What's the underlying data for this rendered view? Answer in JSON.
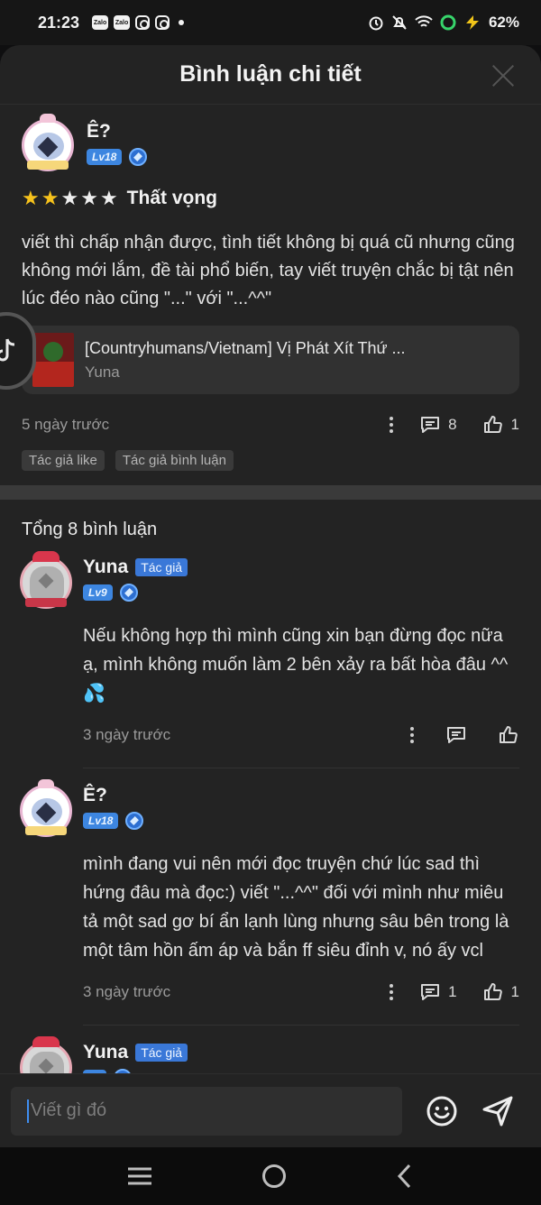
{
  "status_bar": {
    "time": "21:23",
    "left_icons": [
      "zalo-icon",
      "zalo-icon",
      "instagram-icon",
      "instagram-icon"
    ],
    "battery": "62%"
  },
  "sheet": {
    "title": "Bình luận chi tiết"
  },
  "review": {
    "user": {
      "name": "Ê?",
      "level": "Lv18"
    },
    "stars": 2,
    "max_stars": 5,
    "rating_label": "Thất vọng",
    "text": "viết thì chấp nhận được, tình tiết không bị quá cũ nhưng cũng không mới lắm, đề tài phổ biến, tay viết truyện chắc bị tật nên lúc đéo nào cũng \"...\" với \"...^^\"",
    "book": {
      "title": "[Countryhumans/Vietnam] Vị Phát Xít Thứ ...",
      "author": "Yuna"
    },
    "time": "5 ngày trước",
    "comment_count": "8",
    "like_count": "1",
    "tags": [
      "Tác giả like",
      "Tác giả bình luận"
    ]
  },
  "comments_total": "Tổng 8 bình luận",
  "comments": [
    {
      "name": "Yuna",
      "author_badge": "Tác giả",
      "level": "Lv9",
      "text": "Nếu không hợp thì mình cũng xin bạn đừng đọc nữa ạ, mình không muốn làm 2 bên xảy ra bất hòa đâu ^^",
      "time": "3 ngày trước",
      "comment_count": "",
      "like_count": ""
    },
    {
      "name": "Ê?",
      "author_badge": "",
      "level": "Lv18",
      "text": "mình đang vui nên mới đọc truyện chứ lúc sad thì hứng đâu mà đọc:) viết \"...^^\" đối với mình như miêu tả một sad gơ bí ẩn lạnh lùng nhưng sâu bên trong là một tâm hồn ấm áp và bắn ff siêu đỉnh v, nó ấy vcl",
      "time": "3 ngày trước",
      "comment_count": "1",
      "like_count": "1"
    },
    {
      "name": "Yuna",
      "author_badge": "Tác giả"
    }
  ],
  "input": {
    "placeholder": "Viết gì đó"
  },
  "colors": {
    "accent": "#3a78d8",
    "star": "#f6c21c",
    "sheet_bg": "#232323"
  }
}
